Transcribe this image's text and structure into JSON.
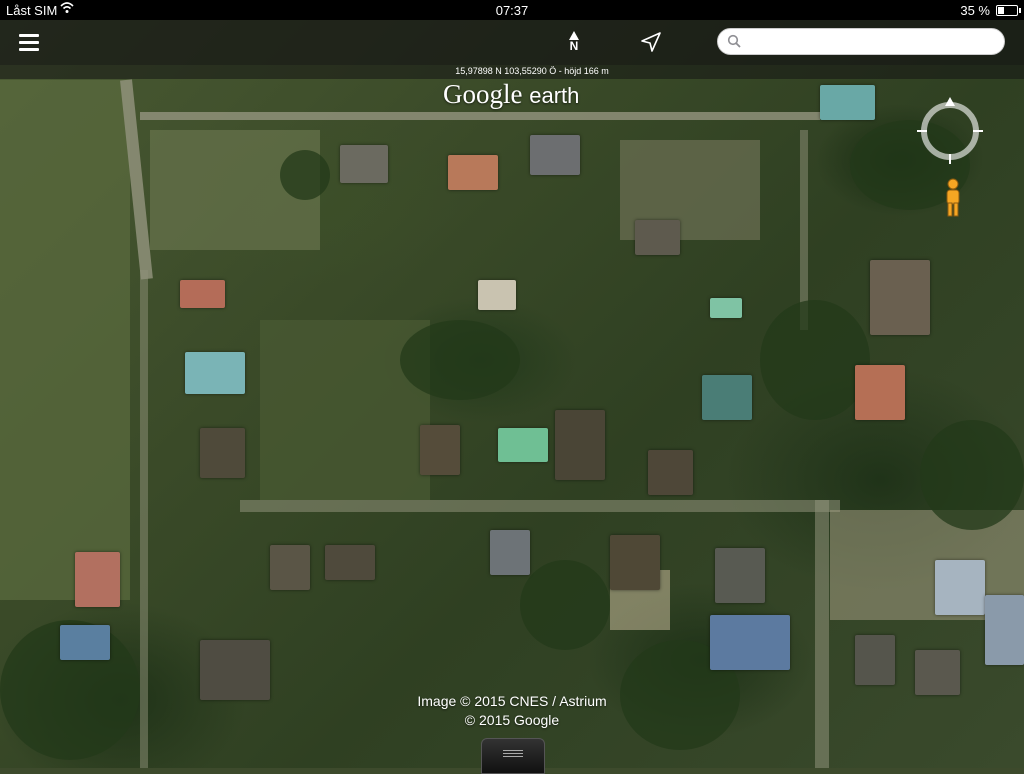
{
  "status_bar": {
    "carrier": "Låst SIM",
    "time": "07:37",
    "battery_percent": "35 %",
    "battery_level": 0.35,
    "wifi_icon": "wifi-icon"
  },
  "toolbar": {
    "menu_icon": "hamburger-menu-icon",
    "north_label": "N",
    "locate_icon": "location-arrow-icon",
    "search": {
      "value": "",
      "placeholder": "",
      "icon": "search-icon"
    }
  },
  "map": {
    "coordinates": "15,97898 N  103,55290 Ö - höjd 166 m",
    "logo_google": "Google",
    "logo_earth": "earth",
    "attribution_line1": "Image © 2015 CNES / Astrium",
    "attribution_line2": "© 2015 Google",
    "compass_icon": "compass-icon",
    "street_view_icon": "pegman-icon"
  }
}
